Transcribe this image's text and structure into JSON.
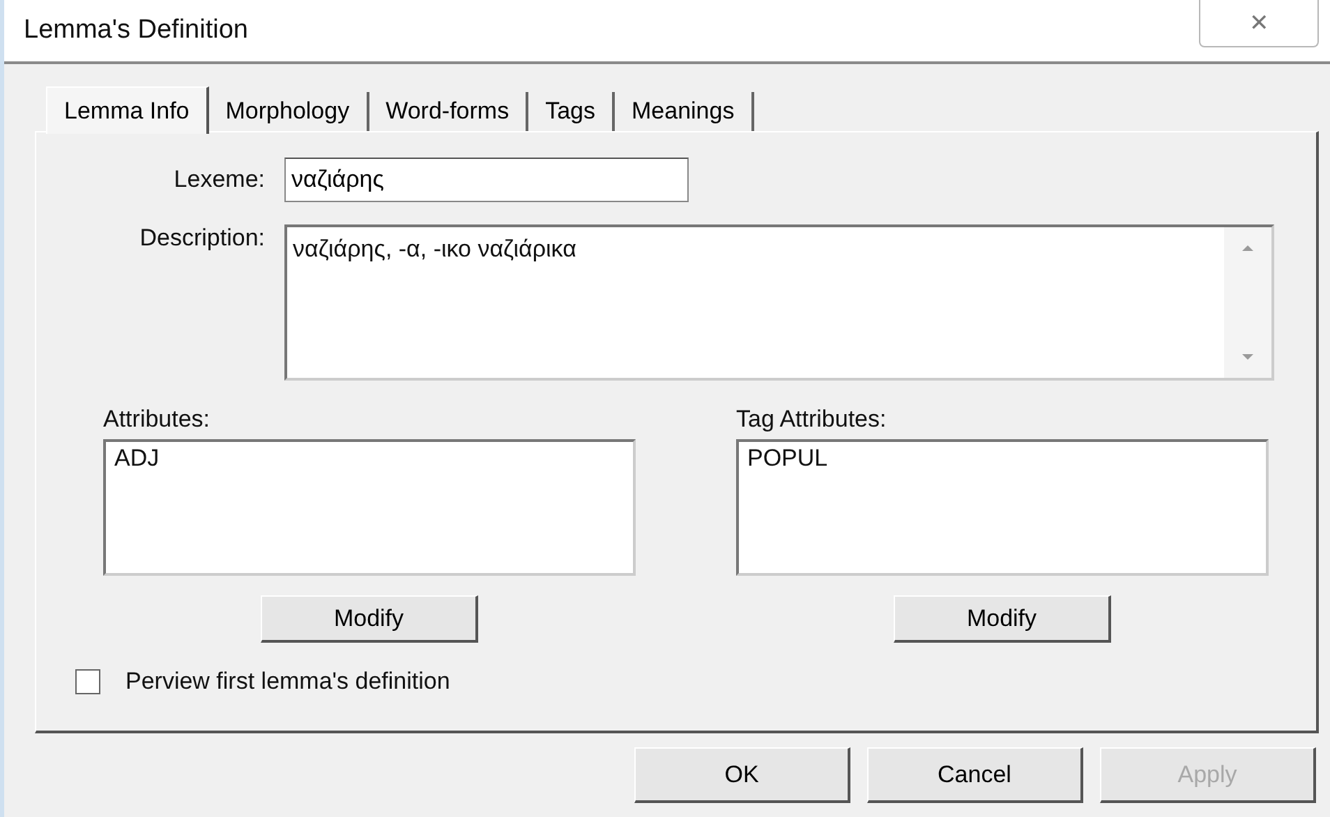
{
  "window": {
    "title": "Lemma's Definition",
    "close": "✕"
  },
  "tabs": [
    {
      "label": "Lemma Info",
      "selected": true
    },
    {
      "label": "Morphology",
      "selected": false
    },
    {
      "label": "Word-forms",
      "selected": false
    },
    {
      "label": "Tags",
      "selected": false
    },
    {
      "label": "Meanings",
      "selected": false
    }
  ],
  "lexeme": {
    "label": "Lexeme:",
    "value": "ναζιάρης"
  },
  "description": {
    "label": "Description:",
    "value": "ναζιάρης, -α, -ικο ναζιάρικα"
  },
  "lists": [
    {
      "label": "Attributes:",
      "items": [
        "ADJ"
      ],
      "button": "Modify"
    },
    {
      "label": "Tag Attributes:",
      "items": [
        "POPUL"
      ],
      "button": "Modify"
    }
  ],
  "preview": {
    "label": "Perview first lemma's definition",
    "checked": false
  },
  "buttons": [
    {
      "label": "OK",
      "disabled": false
    },
    {
      "label": "Cancel",
      "disabled": false
    },
    {
      "label": "Apply",
      "disabled": true
    }
  ]
}
